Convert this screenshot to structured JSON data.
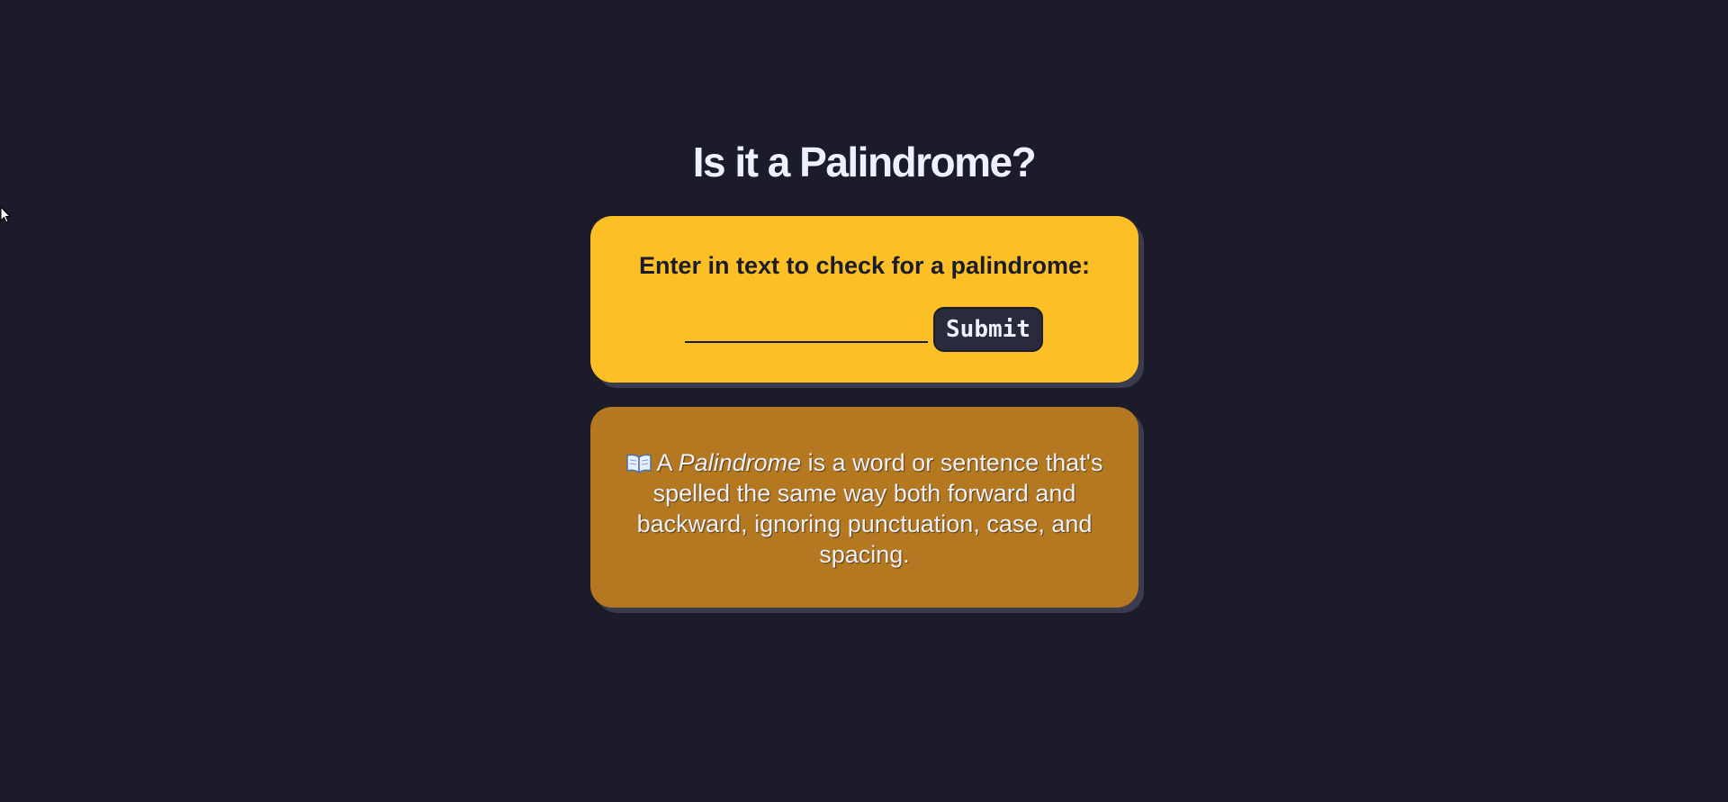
{
  "page": {
    "title": "Is it a Palindrome?"
  },
  "checker": {
    "prompt": "Enter in text to check for a palindrome:",
    "input_value": "",
    "input_placeholder": "",
    "submit_label": "Submit"
  },
  "info": {
    "icon": "open-book-icon",
    "text_lead": "A ",
    "term": "Palindrome",
    "text_rest": " is a word or sentence that's spelled the same way both forward and backward, ignoring punctuation, case, and spacing."
  },
  "colors": {
    "background": "#1b1b2a",
    "primary_card": "#fcc026",
    "info_card": "#b47820",
    "button": "#2a2a3d",
    "text_light": "#eef0fb"
  }
}
